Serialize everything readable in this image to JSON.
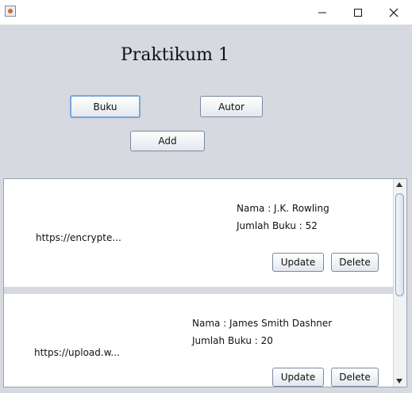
{
  "window": {
    "icon": "java-cup-icon",
    "controls": [
      "minimize-icon",
      "maximize-icon",
      "close-icon"
    ]
  },
  "header": {
    "title": "Praktikum 1"
  },
  "toolbar": {
    "buku_label": "Buku",
    "autor_label": "Autor",
    "add_label": "Add"
  },
  "cards": [
    {
      "url": "https://encrypte...",
      "nama": "Nama : J.K. Rowling",
      "jumlah": "Jumlah Buku : 52",
      "update_label": "Update",
      "delete_label": "Delete"
    },
    {
      "url": "https://upload.w...",
      "nama": "Nama : James Smith Dashner",
      "jumlah": "Jumlah Buku : 20",
      "update_label": "Update",
      "delete_label": "Delete"
    }
  ]
}
